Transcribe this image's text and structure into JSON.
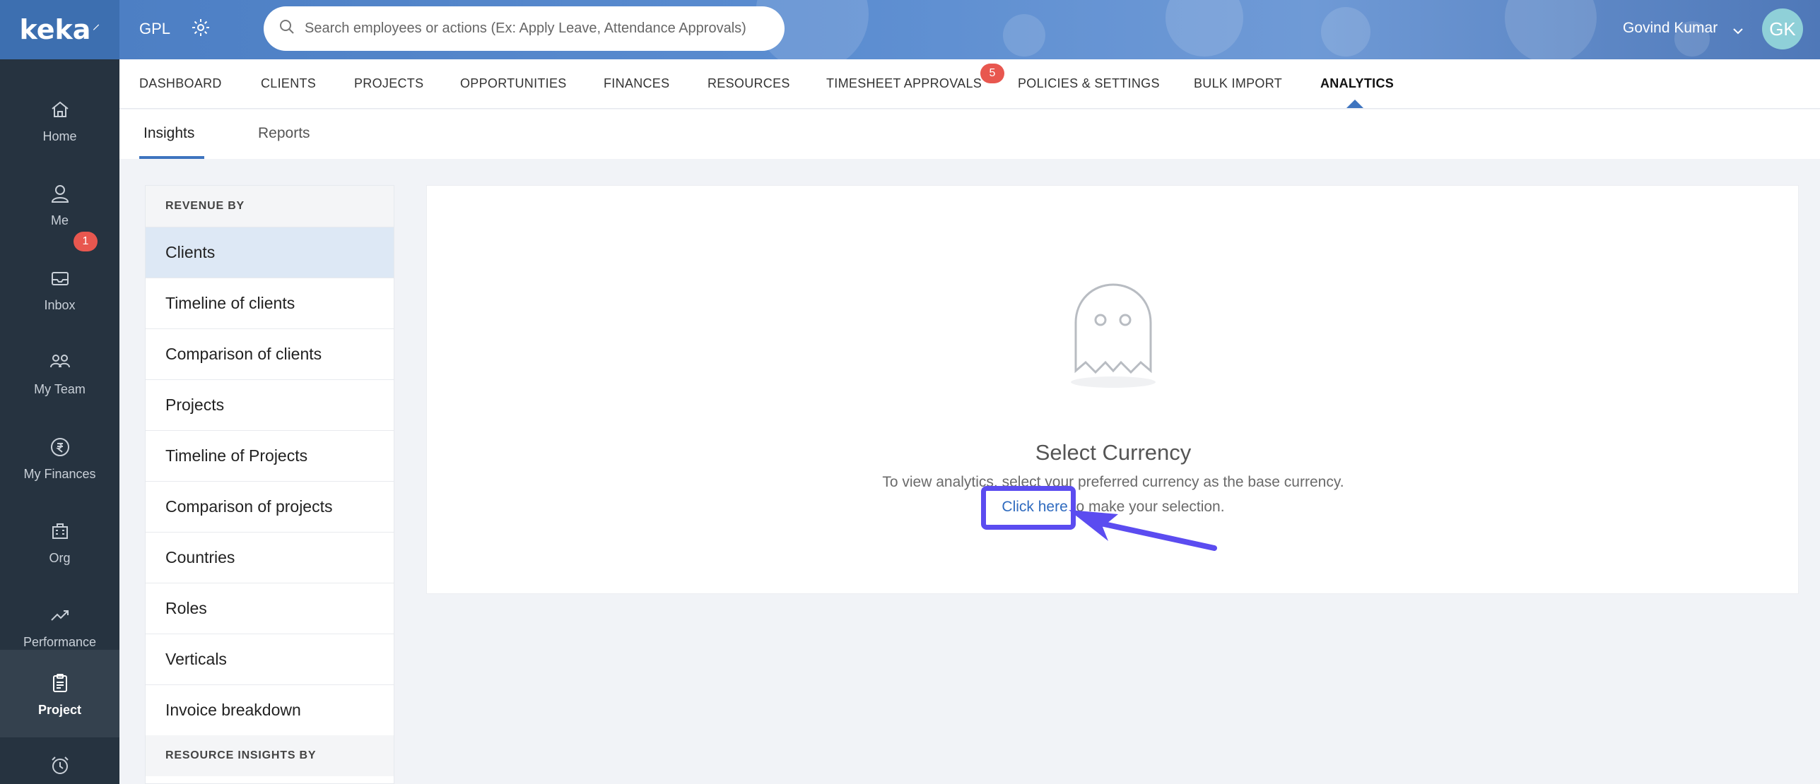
{
  "logo": {
    "text": "keka"
  },
  "sidebar": {
    "items": [
      {
        "label": "Home",
        "icon": "home-icon"
      },
      {
        "label": "Me",
        "icon": "user-icon"
      },
      {
        "label": "Inbox",
        "icon": "inbox-icon",
        "badge": "1"
      },
      {
        "label": "My Team",
        "icon": "team-icon"
      },
      {
        "label": "My Finances",
        "icon": "rupee-icon"
      },
      {
        "label": "Org",
        "icon": "org-icon"
      },
      {
        "label": "Performance",
        "icon": "trend-icon"
      },
      {
        "label": "Project",
        "icon": "clipboard-icon",
        "active": true
      },
      {
        "label": "",
        "icon": "alarm-clock-icon"
      }
    ]
  },
  "header": {
    "org": "GPL",
    "search_placeholder": "Search employees or actions (Ex: Apply Leave, Attendance Approvals)",
    "user_name": "Govind Kumar",
    "user_initials": "GK"
  },
  "module_tabs": [
    {
      "label": "DASHBOARD"
    },
    {
      "label": "CLIENTS"
    },
    {
      "label": "PROJECTS"
    },
    {
      "label": "OPPORTUNITIES"
    },
    {
      "label": "FINANCES"
    },
    {
      "label": "RESOURCES"
    },
    {
      "label": "TIMESHEET APPROVALS",
      "badge": "5"
    },
    {
      "label": "POLICIES & SETTINGS"
    },
    {
      "label": "BULK IMPORT"
    },
    {
      "label": "ANALYTICS",
      "active": true
    }
  ],
  "sub_tabs": [
    {
      "label": "Insights",
      "active": true
    },
    {
      "label": "Reports"
    }
  ],
  "panel": {
    "revenue_header": "REVENUE BY",
    "revenue_items": [
      "Clients",
      "Timeline of clients",
      "Comparison of clients",
      "Projects",
      "Timeline of Projects",
      "Comparison of projects",
      "Countries",
      "Roles",
      "Verticals",
      "Invoice breakdown"
    ],
    "resource_header": "RESOURCE INSIGHTS BY"
  },
  "empty_state": {
    "title": "Select Currency",
    "description": "To view analytics, select your preferred currency as the base currency.",
    "link_text": "Click here",
    "action_suffix": " to make your selection."
  },
  "colors": {
    "brand_blue": "#3d6fb0",
    "sidebar_bg": "#263340",
    "badge_red": "#e8574f",
    "highlight_purple": "#5b4cf0"
  }
}
